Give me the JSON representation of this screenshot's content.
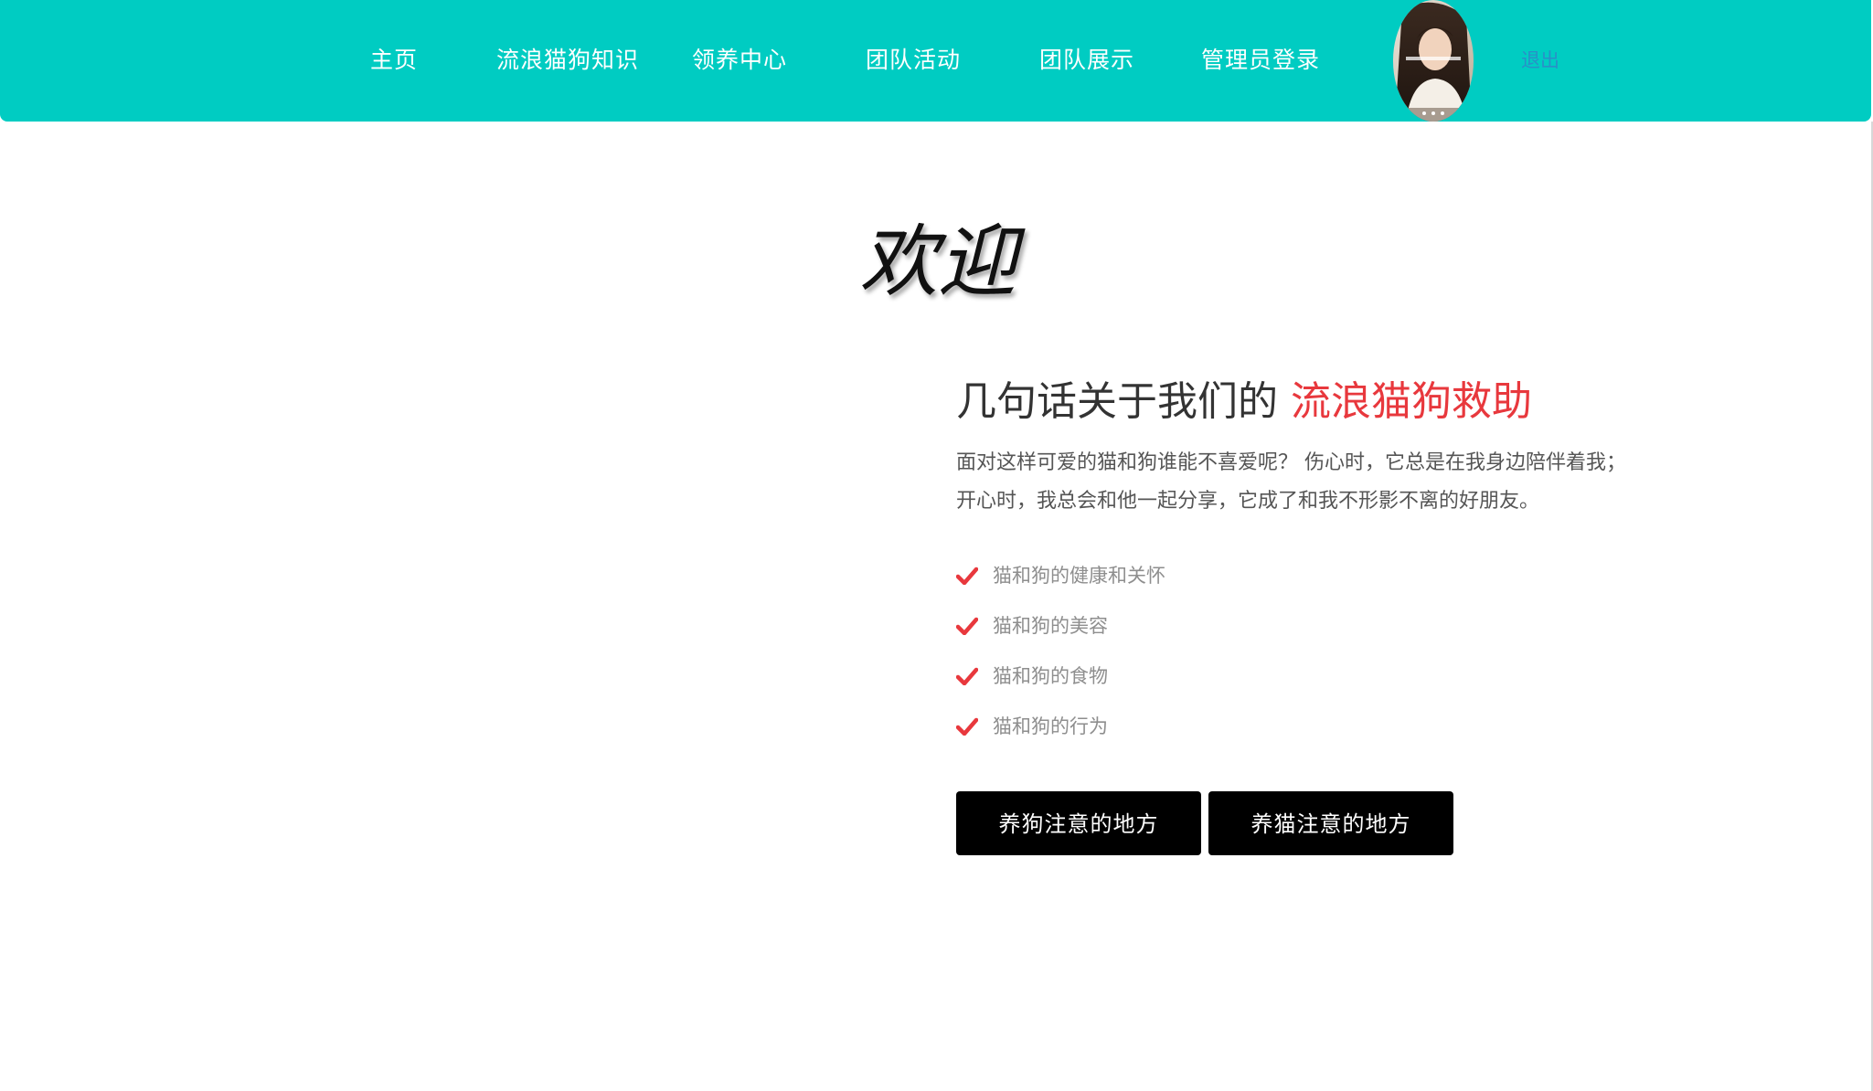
{
  "nav": {
    "items": [
      {
        "label": "主页"
      },
      {
        "label": "流浪猫狗知识"
      },
      {
        "label": "领养中心"
      },
      {
        "label": "团队活动"
      },
      {
        "label": "团队展示"
      },
      {
        "label": "管理员登录"
      }
    ],
    "logout_label": "退出",
    "avatar_icon": "user-avatar-photo"
  },
  "main": {
    "welcome": "欢迎",
    "about_title_prefix": "几句话关于我们的",
    "about_title_highlight": "流浪猫狗救助",
    "intro_lines": [
      "面对这样可爱的猫和狗谁能不喜爱呢？ 伤心时，它总是在我身边陪伴着我；",
      "开心时，我总会和他一起分享，它成了和我不形影不离的好朋友。"
    ],
    "features": [
      {
        "label": "猫和狗的健康和关怀",
        "icon": "check-icon"
      },
      {
        "label": "猫和狗的美容",
        "icon": "check-icon"
      },
      {
        "label": "猫和狗的食物",
        "icon": "check-icon"
      },
      {
        "label": "猫和狗的行为",
        "icon": "check-icon"
      }
    ],
    "buttons": {
      "dog_label": "养狗注意的地方",
      "cat_label": "养猫注意的地方"
    }
  },
  "colors": {
    "nav_bg": "#00ccc2",
    "highlight": "#e8383d",
    "button_bg": "#000000",
    "logout_link": "#2a8fc8"
  }
}
